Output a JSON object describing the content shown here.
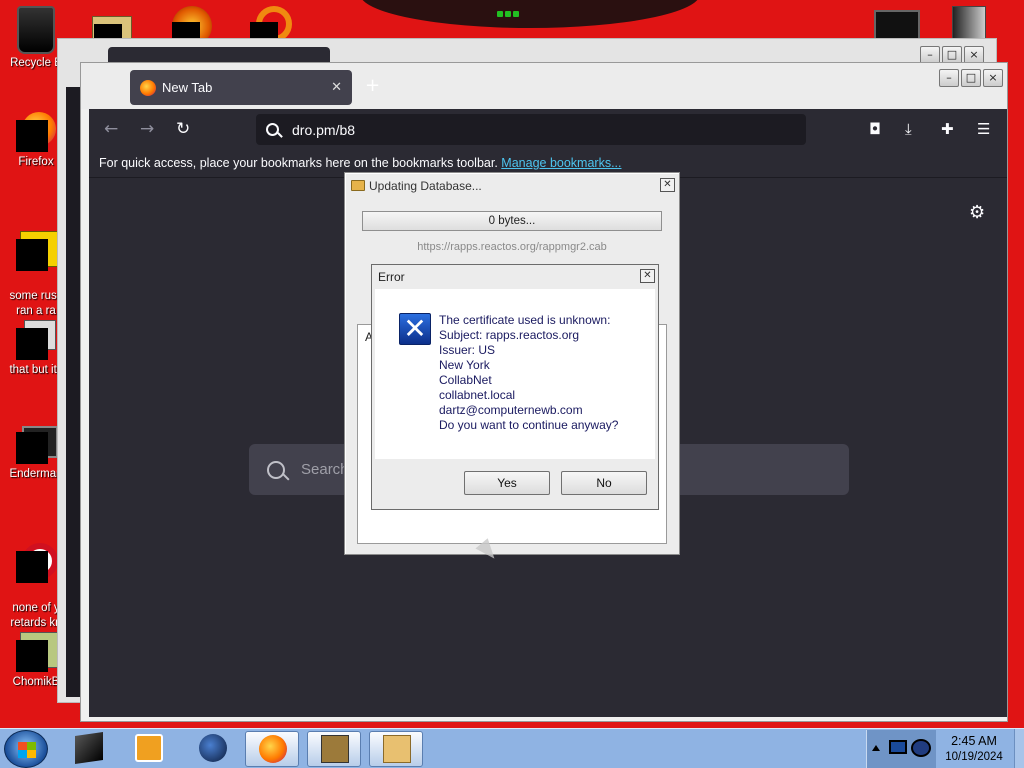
{
  "desktop": {
    "icons": [
      {
        "label": "Recycle B"
      },
      {
        "label": "Firefox"
      },
      {
        "label": "some russ\nran a ra"
      },
      {
        "label": "that but its"
      },
      {
        "label": "Enderman"
      },
      {
        "label": "none of y\nretards kn"
      },
      {
        "label": "ChomikB"
      }
    ]
  },
  "browser": {
    "tab_title": "New Tab",
    "url": "dro.pm/b8",
    "bookmarks_hint": "For quick access, place your bookmarks here on the bookmarks toolbar.",
    "manage_bookmarks_link": "Manage bookmarks...",
    "search_placeholder": "Search"
  },
  "updating_dialog": {
    "title": "Updating Database...",
    "progress_text": "0 bytes...",
    "progress_fraction": 0,
    "url": "https://rapps.reactos.org/rappmgr2.cab",
    "log_text": "A"
  },
  "error_dialog": {
    "title": "Error",
    "lines": [
      "The certificate used is unknown:",
      "Subject: rapps.reactos.org",
      "Issuer: US",
      "New York",
      "CollabNet",
      "collabnet.local",
      "dartz@computernewb.com",
      "Do you want to continue anyway?"
    ],
    "yes_label": "Yes",
    "no_label": "No"
  },
  "taskbar": {
    "clock_time": "2:45 AM",
    "clock_date": "10/19/2024",
    "items": [
      {
        "icon": "cube-icon",
        "active": false
      },
      {
        "icon": "media-player-icon",
        "active": false
      },
      {
        "icon": "globe-icon",
        "active": false
      },
      {
        "icon": "firefox-icon",
        "active": true
      },
      {
        "icon": "chomikbox-icon",
        "active": true
      },
      {
        "icon": "package-icon",
        "active": true
      }
    ]
  },
  "colors": {
    "desktop_bg": "#e01414",
    "browser_dark": "#2b2a33",
    "link": "#4dc5ef",
    "taskbar": "#8fb3e3"
  }
}
